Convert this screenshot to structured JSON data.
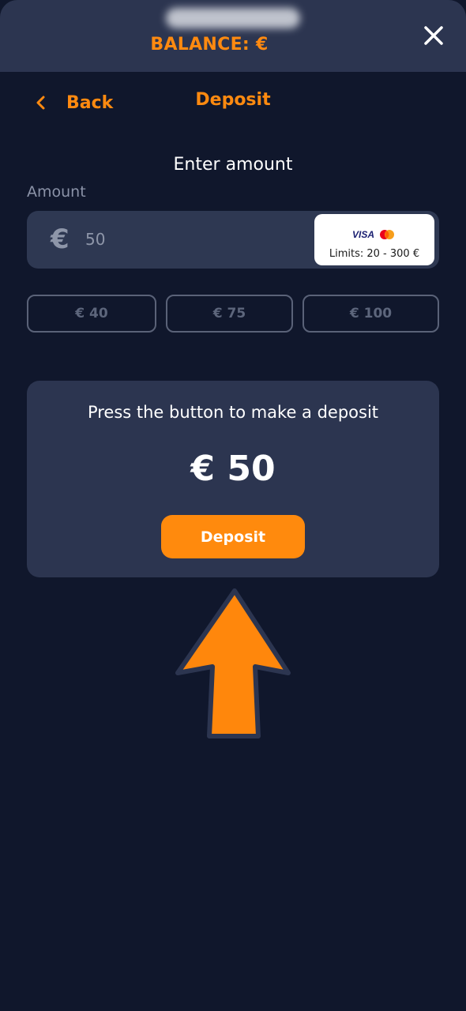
{
  "header": {
    "balance_label": "BALANCE: €",
    "close_icon": "close-icon"
  },
  "nav": {
    "back_label": "Back",
    "back_icon": "chevron-left-icon",
    "title": "Deposit"
  },
  "form": {
    "heading": "Enter amount",
    "amount_label": "Amount",
    "currency_symbol": "€",
    "amount_value": "50",
    "payment_brands": [
      "VISA",
      "Mastercard"
    ],
    "visa_label": "VISA",
    "limits_text": "Limits: 20 - 300 €",
    "quick_amounts": [
      "€ 40",
      "€ 75",
      "€ 100"
    ]
  },
  "summary": {
    "instruction": "Press the button to make a deposit",
    "amount": "€ 50",
    "deposit_button": "Deposit"
  },
  "colors": {
    "background": "#10172c",
    "panel": "#2c3550",
    "accent": "#ff8a0d"
  }
}
